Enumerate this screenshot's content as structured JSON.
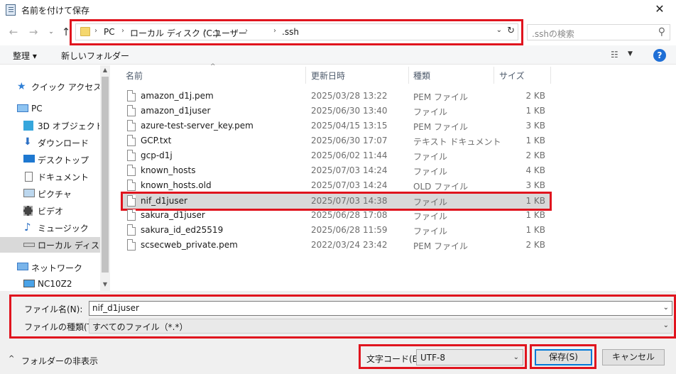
{
  "window": {
    "title": "名前を付けて保存",
    "close_glyph": "✕"
  },
  "nav": {
    "back": "←",
    "forward": "→",
    "recent": "⌄",
    "up": "↑"
  },
  "address": {
    "crumbs": [
      "PC",
      "ローカル ディスク (C:)",
      "ユーザー",
      "",
      ".ssh"
    ],
    "separator": "›",
    "dropdown": "⌄",
    "refresh": "↻"
  },
  "search": {
    "placeholder": ".sshの検索",
    "icon": "⚲"
  },
  "toolbar": {
    "organize": "整理 ▾",
    "new_folder": "新しいフォルダー",
    "view_icon": "☷",
    "view_dropdown": "▼",
    "help": "?"
  },
  "sidebar": {
    "items": [
      {
        "label": "クイック アクセス",
        "icon": "star-icon"
      },
      {
        "label": "PC",
        "icon": "computer-icon"
      },
      {
        "label": "3D オブジェクト",
        "icon": "cube-icon"
      },
      {
        "label": "ダウンロード",
        "icon": "download-icon"
      },
      {
        "label": "デスクトップ",
        "icon": "desktop-icon"
      },
      {
        "label": "ドキュメント",
        "icon": "document-icon"
      },
      {
        "label": "ピクチャ",
        "icon": "picture-icon"
      },
      {
        "label": "ビデオ",
        "icon": "video-icon"
      },
      {
        "label": "ミュージック",
        "icon": "music-icon"
      },
      {
        "label": "ローカル ディスク (C",
        "icon": "drive-icon"
      },
      {
        "label": "ネットワーク",
        "icon": "network-icon"
      },
      {
        "label": "NC10Z2",
        "icon": "monitor-icon"
      }
    ]
  },
  "columns": {
    "name": "名前",
    "date": "更新日時",
    "type": "種類",
    "size": "サイズ",
    "sort": "^"
  },
  "files": [
    {
      "name": "amazon_d1j.pem",
      "date": "2025/03/28 13:22",
      "type": "PEM ファイル",
      "size": "2 KB"
    },
    {
      "name": "amazon_d1juser",
      "date": "2025/06/30 13:40",
      "type": "ファイル",
      "size": "1 KB"
    },
    {
      "name": "azure-test-server_key.pem",
      "date": "2025/04/15 13:15",
      "type": "PEM ファイル",
      "size": "3 KB"
    },
    {
      "name": "GCP.txt",
      "date": "2025/06/30 17:07",
      "type": "テキスト ドキュメント",
      "size": "1 KB"
    },
    {
      "name": "gcp-d1j",
      "date": "2025/06/02 11:44",
      "type": "ファイル",
      "size": "2 KB"
    },
    {
      "name": "known_hosts",
      "date": "2025/07/03 14:24",
      "type": "ファイル",
      "size": "4 KB"
    },
    {
      "name": "known_hosts.old",
      "date": "2025/07/03 14:24",
      "type": "OLD ファイル",
      "size": "3 KB"
    },
    {
      "name": "nif_d1juser",
      "date": "2025/07/03 14:38",
      "type": "ファイル",
      "size": "1 KB"
    },
    {
      "name": "sakura_d1juser",
      "date": "2025/06/28 17:08",
      "type": "ファイル",
      "size": "1 KB"
    },
    {
      "name": "sakura_id_ed25519",
      "date": "2025/06/28 11:59",
      "type": "ファイル",
      "size": "1 KB"
    },
    {
      "name": "scsecweb_private.pem",
      "date": "2022/03/24 23:42",
      "type": "PEM ファイル",
      "size": "2 KB"
    }
  ],
  "form": {
    "filename_label": "ファイル名(N):",
    "filename_value": "nif_d1juser",
    "filetype_label": "ファイルの種類(T):",
    "filetype_value": "すべてのファイル（*.*）",
    "dropdown": "⌄",
    "hide_folders": "フォルダーの非表示",
    "hide_caret": "^",
    "encoding_label": "文字コード(E):",
    "encoding_value": "UTF-8",
    "save": "保存(S)",
    "cancel": "キャンセル"
  },
  "colors": {
    "highlight": "#e0141e",
    "accent": "#0078d7",
    "selected_row": "#d9d9d9"
  }
}
